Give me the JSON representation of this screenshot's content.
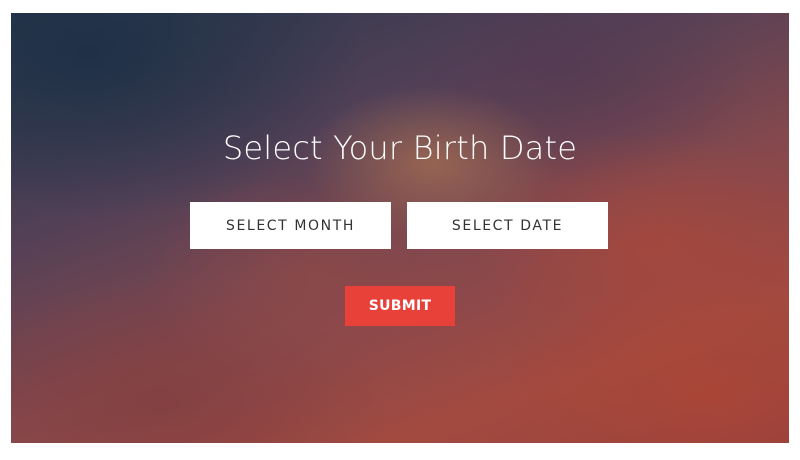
{
  "page": {
    "title": "Select Your Birth Date"
  },
  "form": {
    "month_select_label": "SELECT MONTH",
    "date_select_label": "SELECT DATE",
    "submit_label": "SUBMIT"
  },
  "colors": {
    "submit_button": "#e8413a",
    "select_background": "#ffffff",
    "title_text": "#ffffff"
  }
}
